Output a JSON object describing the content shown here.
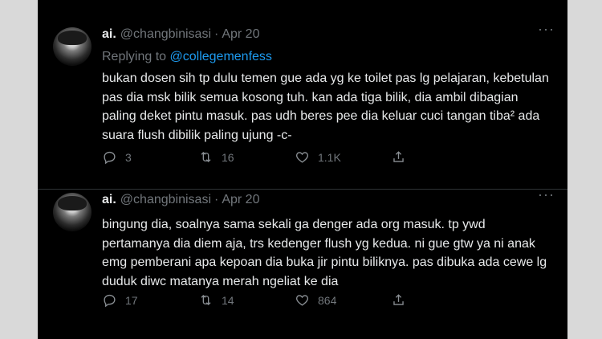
{
  "tweets": [
    {
      "name": "ai.",
      "handle": "@changbinisasi",
      "separator": "·",
      "date": "Apr 20",
      "more": "···",
      "replying_prefix": "Replying to ",
      "replying_mention": "@collegemenfess",
      "text": "bukan dosen sih tp dulu temen gue ada yg ke toilet pas lg pelajaran, kebetulan pas dia msk bilik semua kosong tuh. kan ada tiga bilik, dia ambil dibagian paling deket pintu masuk. pas udh beres pee dia keluar cuci tangan tiba² ada suara flush dibilik paling ujung -c-",
      "replies": "3",
      "retweets": "16",
      "likes": "1.1K"
    },
    {
      "name": "ai.",
      "handle": "@changbinisasi",
      "separator": "·",
      "date": "Apr 20",
      "more": "···",
      "text": "bingung dia, soalnya sama sekali ga denger ada org masuk. tp ywd pertamanya dia diem aja, trs kedenger flush yg kedua. ni gue gtw ya ni anak emg pemberani apa kepoan dia buka jir pintu biliknya. pas dibuka ada cewe lg duduk diwc matanya merah ngeliat ke dia",
      "replies": "17",
      "retweets": "14",
      "likes": "864"
    }
  ],
  "icons": [
    "reply-icon",
    "retweet-icon",
    "like-icon",
    "share-icon"
  ],
  "colors": {
    "background": "#000000",
    "text": "#e7e9ea",
    "muted": "#71767b",
    "link": "#1d9bf0"
  }
}
